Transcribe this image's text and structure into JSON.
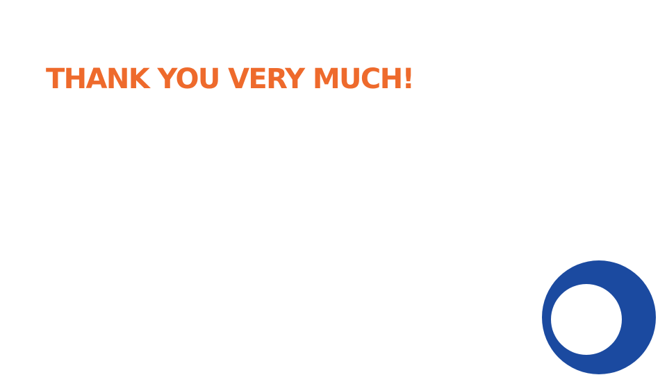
{
  "slide": {
    "title": "THANK YOU VERY MUCH!"
  },
  "decoration": {
    "icon": "crescent-ring-icon"
  },
  "colors": {
    "background": "#ffffff",
    "title": "#ee6a2c",
    "ring": "#1b4aa0"
  }
}
